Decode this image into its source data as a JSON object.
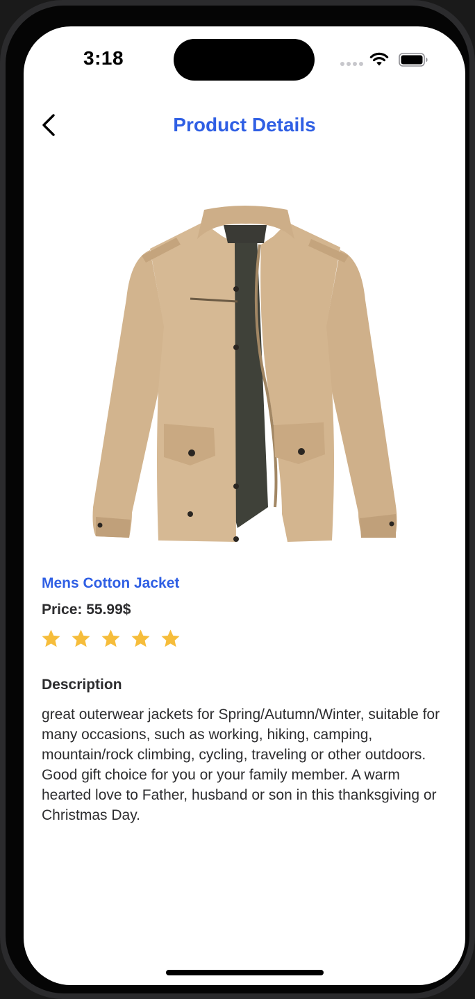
{
  "status_bar": {
    "time": "3:18",
    "icons": [
      "cellular-signal-icon",
      "wifi-icon",
      "battery-icon"
    ]
  },
  "nav": {
    "title": "Product Details",
    "back_icon": "chevron-left-icon"
  },
  "product": {
    "image_alt": "beige cotton jacket product image",
    "title": "Mens Cotton Jacket",
    "price_text": "Price: 55.99$",
    "rating": 5,
    "rating_max": 5,
    "description_heading": "Description",
    "description": "great outerwear jackets for Spring/Autumn/Winter, suitable for many occasions, such as working, hiking, camping, mountain/rock climbing, cycling, traveling or other outdoors. Good gift choice for you or your family member. A warm hearted love to Father, husband or son in this thanksgiving or Christmas Day."
  },
  "colors": {
    "accent": "#2f5fe4",
    "text": "#2c2c2e",
    "star": "#f6bd3b",
    "background": "#ffffff"
  }
}
